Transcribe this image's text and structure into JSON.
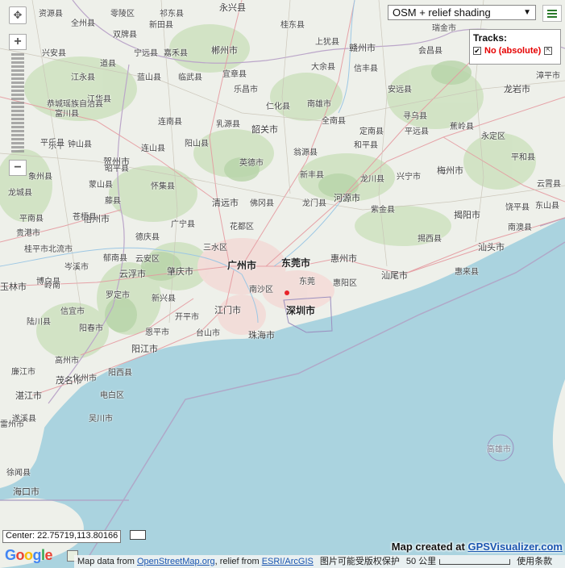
{
  "map_type": {
    "label": "OSM + relief shading"
  },
  "tracks": {
    "title": "Tracks:",
    "items": [
      {
        "name": "No (absolute)",
        "checked": true
      }
    ]
  },
  "zoom": {
    "plus": "+",
    "minus": "−"
  },
  "center": "Center: 22.75719,113.80166",
  "credit": {
    "prefix": "Map created at ",
    "link": "GPSVisualizer.com"
  },
  "attribution": {
    "data_prefix": "Map data from ",
    "osm_link": "OpenStreetMap.org",
    "relief_prefix": ", relief from ",
    "esri_link": "ESRI/ArcGIS",
    "copyright": "图片可能受版权保护",
    "scale": "50 公里",
    "terms": "使用条款"
  },
  "google": [
    "G",
    "o",
    "o",
    "g",
    "l",
    "e"
  ],
  "places": [
    {
      "name": "永兴县",
      "cls": "city"
    },
    {
      "name": "资源县",
      "cls": ""
    },
    {
      "name": "零陵区",
      "cls": ""
    },
    {
      "name": "祁东县",
      "cls": ""
    },
    {
      "name": "上犹县",
      "cls": ""
    },
    {
      "name": "瑞金市",
      "cls": ""
    },
    {
      "name": "全州县",
      "cls": ""
    },
    {
      "name": "新田县",
      "cls": ""
    },
    {
      "name": "桂东县",
      "cls": ""
    },
    {
      "name": "双牌县",
      "cls": ""
    },
    {
      "name": "宁远县",
      "cls": ""
    },
    {
      "name": "嘉禾县",
      "cls": ""
    },
    {
      "name": "郴州市",
      "cls": "city"
    },
    {
      "name": "大余县",
      "cls": ""
    },
    {
      "name": "赣州市",
      "cls": "city"
    },
    {
      "name": "会昌县",
      "cls": ""
    },
    {
      "name": "兴安县",
      "cls": ""
    },
    {
      "name": "道县",
      "cls": ""
    },
    {
      "name": "蓝山县",
      "cls": ""
    },
    {
      "name": "临武县",
      "cls": ""
    },
    {
      "name": "宜章县",
      "cls": ""
    },
    {
      "name": "信丰县",
      "cls": ""
    },
    {
      "name": "漳平市",
      "cls": ""
    },
    {
      "name": "江永县",
      "cls": ""
    },
    {
      "name": "乐昌市",
      "cls": ""
    },
    {
      "name": "安远县",
      "cls": ""
    },
    {
      "name": "龙岩市",
      "cls": "city"
    },
    {
      "name": "恭城瑶族自治县",
      "cls": ""
    },
    {
      "name": "江华县",
      "cls": ""
    },
    {
      "name": "仁化县",
      "cls": ""
    },
    {
      "name": "南雄市",
      "cls": ""
    },
    {
      "name": "寻乌县",
      "cls": ""
    },
    {
      "name": "连南县",
      "cls": ""
    },
    {
      "name": "乳源县",
      "cls": ""
    },
    {
      "name": "全南县",
      "cls": ""
    },
    {
      "name": "富川县",
      "cls": ""
    },
    {
      "name": "韶关市",
      "cls": "city"
    },
    {
      "name": "定南县",
      "cls": ""
    },
    {
      "name": "平远县",
      "cls": ""
    },
    {
      "name": "蕉岭县",
      "cls": ""
    },
    {
      "name": "永定区",
      "cls": ""
    },
    {
      "name": "钟山县",
      "cls": ""
    },
    {
      "name": "连山县",
      "cls": ""
    },
    {
      "name": "阳山县",
      "cls": ""
    },
    {
      "name": "翁源县",
      "cls": ""
    },
    {
      "name": "和平县",
      "cls": ""
    },
    {
      "name": "平和县",
      "cls": ""
    },
    {
      "name": "贺州市",
      "cls": "city"
    },
    {
      "name": "英德市",
      "cls": ""
    },
    {
      "name": "新丰县",
      "cls": ""
    },
    {
      "name": "龙川县",
      "cls": ""
    },
    {
      "name": "兴宁市",
      "cls": ""
    },
    {
      "name": "梅州市",
      "cls": "city"
    },
    {
      "name": "云霄县",
      "cls": ""
    },
    {
      "name": "怀集县",
      "cls": ""
    },
    {
      "name": "河源市",
      "cls": "city"
    },
    {
      "name": "东山县",
      "cls": ""
    },
    {
      "name": "清远市",
      "cls": "city"
    },
    {
      "name": "佛冈县",
      "cls": ""
    },
    {
      "name": "龙门县",
      "cls": ""
    },
    {
      "name": "紫金县",
      "cls": ""
    },
    {
      "name": "饶平县",
      "cls": ""
    },
    {
      "name": "梧州市",
      "cls": "city"
    },
    {
      "name": "揭阳市",
      "cls": "city"
    },
    {
      "name": "平南县",
      "cls": ""
    },
    {
      "name": "广宁县",
      "cls": ""
    },
    {
      "name": "花都区",
      "cls": ""
    },
    {
      "name": "南澳县",
      "cls": ""
    },
    {
      "name": "德庆县",
      "cls": ""
    },
    {
      "name": "揭西县",
      "cls": ""
    },
    {
      "name": "汕头市",
      "cls": "city"
    },
    {
      "name": "三水区",
      "cls": ""
    },
    {
      "name": "郁南县",
      "cls": ""
    },
    {
      "name": "云安区",
      "cls": ""
    },
    {
      "name": "广州市",
      "cls": "major"
    },
    {
      "name": "东莞市",
      "cls": "major"
    },
    {
      "name": "惠州市",
      "cls": "city"
    },
    {
      "name": "岑溪市",
      "cls": ""
    },
    {
      "name": "云浮市",
      "cls": "city"
    },
    {
      "name": "肇庆市",
      "cls": "city"
    },
    {
      "name": "汕尾市",
      "cls": "city"
    },
    {
      "name": "惠来县",
      "cls": ""
    },
    {
      "name": "东莞",
      "cls": ""
    },
    {
      "name": "惠阳区",
      "cls": ""
    },
    {
      "name": "南沙区",
      "cls": ""
    },
    {
      "name": "玉林市",
      "cls": "city"
    },
    {
      "name": "罗定市",
      "cls": ""
    },
    {
      "name": "新兴县",
      "cls": ""
    },
    {
      "name": "深圳市",
      "cls": "major"
    },
    {
      "name": "江门市",
      "cls": "city"
    },
    {
      "name": "开平市",
      "cls": ""
    },
    {
      "name": "陆川县",
      "cls": ""
    },
    {
      "name": "信宜市",
      "cls": ""
    },
    {
      "name": "恩平市",
      "cls": ""
    },
    {
      "name": "台山市",
      "cls": ""
    },
    {
      "name": "珠海市",
      "cls": "city"
    },
    {
      "name": "阳春市",
      "cls": ""
    },
    {
      "name": "阳江市",
      "cls": "city"
    },
    {
      "name": "高州市",
      "cls": ""
    },
    {
      "name": "廉江市",
      "cls": ""
    },
    {
      "name": "阳西县",
      "cls": ""
    },
    {
      "name": "茂名市",
      "cls": "city"
    },
    {
      "name": "湛江市",
      "cls": "city"
    },
    {
      "name": "电白区",
      "cls": ""
    },
    {
      "name": "雷州市",
      "cls": ""
    },
    {
      "name": "高雄市",
      "cls": "water"
    },
    {
      "name": "徐闻县",
      "cls": ""
    },
    {
      "name": "海口市",
      "cls": "city"
    },
    {
      "name": "平乐县",
      "cls": ""
    },
    {
      "name": "昭平县",
      "cls": ""
    },
    {
      "name": "蒙山县",
      "cls": ""
    },
    {
      "name": "藤县",
      "cls": ""
    },
    {
      "name": "苍梧县",
      "cls": ""
    },
    {
      "name": "贵港市",
      "cls": ""
    },
    {
      "name": "北流市",
      "cls": ""
    },
    {
      "name": "博白县",
      "cls": ""
    },
    {
      "name": "化州市",
      "cls": ""
    },
    {
      "name": "吴川市",
      "cls": ""
    },
    {
      "name": "遂溪县",
      "cls": ""
    },
    {
      "name": "岭南",
      "cls": ""
    },
    {
      "name": "乐平",
      "cls": ""
    },
    {
      "name": "象州县",
      "cls": ""
    },
    {
      "name": "龙城县",
      "cls": ""
    },
    {
      "name": "桂平市",
      "cls": ""
    }
  ],
  "marker": {
    "color": "#e8232a"
  }
}
